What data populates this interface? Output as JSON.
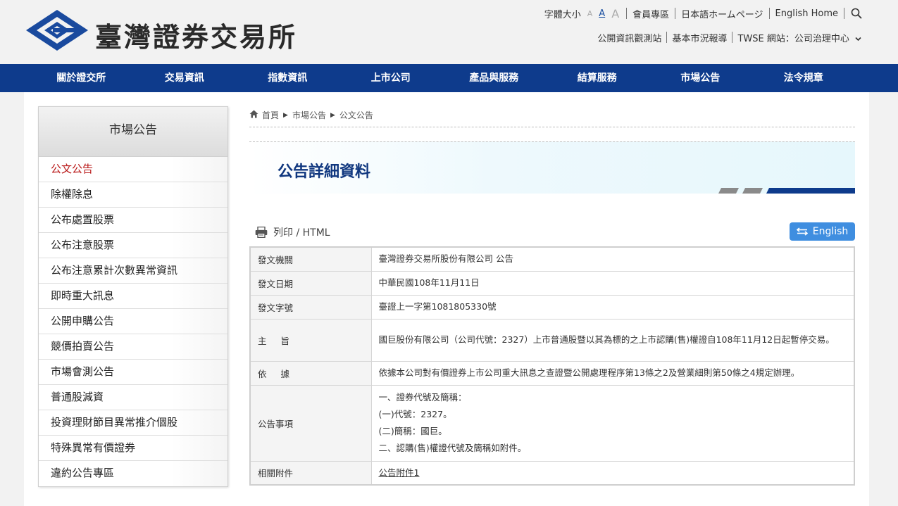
{
  "header": {
    "logo_text": "臺灣證券交易所",
    "font_size_label": "字體大小",
    "font_size_options": [
      "A",
      "A",
      "A"
    ],
    "member_zone": "會員專區",
    "japanese_home": "日本語ホームページ",
    "english_home": "English Home",
    "mops": "公開資訊觀測站",
    "basic_report": "基本市況報導",
    "twse_sites": "TWSE 網站：公司治理中心"
  },
  "nav": {
    "items": [
      "關於證交所",
      "交易資訊",
      "指數資訊",
      "上市公司",
      "產品與服務",
      "結算服務",
      "市場公告",
      "法令規章"
    ]
  },
  "sidebar": {
    "title": "市場公告",
    "items": [
      "公文公告",
      "除權除息",
      "公布處置股票",
      "公布注意股票",
      "公布注意累計次數異常資訊",
      "即時重大訊息",
      "公開申購公告",
      "競價拍賣公告",
      "市場會測公告",
      "普通股減資",
      "投資理財節目異常推介個股",
      "特殊異常有價證券",
      "違約公告專區"
    ]
  },
  "breadcrumb": {
    "home": "首頁",
    "level1": "市場公告",
    "level2": "公文公告"
  },
  "main": {
    "title": "公告詳細資料",
    "print_label": "列印 / HTML",
    "english_button": "English"
  },
  "detail": {
    "issuer_label": "發文機關",
    "issuer_value": "臺灣證券交易所股份有限公司 公告",
    "date_label": "發文日期",
    "date_value": "中華民國108年11月11日",
    "ref_label": "發文字號",
    "ref_value": "臺證上一字第1081805330號",
    "subject_label_1": "主",
    "subject_label_2": "旨",
    "subject_value": "國巨股份有限公司（公司代號：2327）上市普通股暨以其為標的之上市認購(售)權證自108年11月12日起暫停交易。",
    "basis_label_1": "依",
    "basis_label_2": "據",
    "basis_value": "依據本公司對有價證券上市公司重大訊息之查證暨公開處理程序第13條之2及營業細則第50條之4規定辦理。",
    "items_label": "公告事項",
    "items_lines": [
      "一、證券代號及簡稱：",
      "(一)代號：2327。",
      "(二)簡稱：國巨。",
      "二、認購(售)權證代號及簡稱如附件。"
    ],
    "attachment_label": "相關附件",
    "attachment_link": "公告附件1"
  },
  "colors": {
    "nav_bg": "#0e3b8c",
    "title_color": "#10377f",
    "english_btn": "#3f8ee0",
    "active_side": "#b81414"
  }
}
